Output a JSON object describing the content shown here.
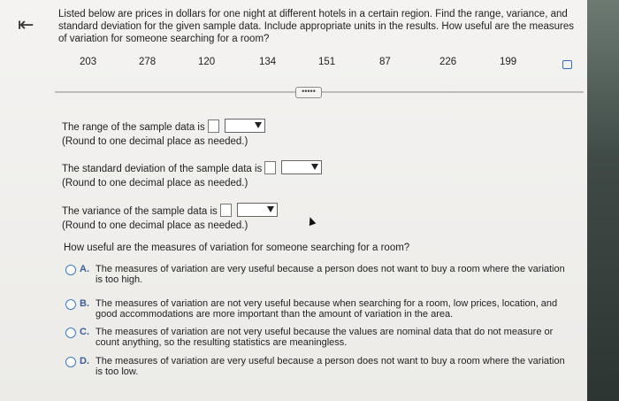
{
  "question": {
    "text": "Listed below are prices in dollars for one night at different hotels in a certain region. Find the range, variance, and standard deviation for the given sample data. Include appropriate units in the results. How useful are the measures of variation for someone searching for a room?"
  },
  "data_values": [
    "203",
    "278",
    "120",
    "134",
    "151",
    "87",
    "226",
    "199"
  ],
  "more_button": "•••••",
  "answers": {
    "range_label": "The range of the sample data is",
    "range_note": "(Round to one decimal place as needed.)",
    "std_label": "The standard deviation of the sample data is",
    "std_note": "(Round to one decimal place as needed.)",
    "variance_label": "The variance of the sample data is",
    "variance_note": "(Round to one decimal place as needed.)"
  },
  "mc": {
    "question": "How useful are the measures of variation for someone searching for a room?",
    "options": [
      {
        "letter": "A.",
        "text": "The measures of variation are very useful because a person does not want to buy a room where the variation is too high."
      },
      {
        "letter": "B.",
        "text": "The measures of variation are not very useful because when searching for a room, low prices, location, and good accommodations are more important than the amount of variation in the area."
      },
      {
        "letter": "C.",
        "text": "The measures of variation are not very useful because the values are nominal data that do not measure or count anything, so the resulting statistics are meaningless."
      },
      {
        "letter": "D.",
        "text": "The measures of variation are very useful because a person does not want to buy a room where the variation is too low."
      }
    ]
  }
}
